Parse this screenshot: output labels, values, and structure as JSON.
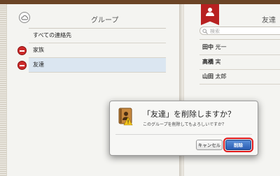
{
  "left_page": {
    "title": "グループ",
    "groups": [
      {
        "label": "すべての連絡先",
        "deletable": false,
        "selected": false
      },
      {
        "label": "家族",
        "deletable": true,
        "selected": false
      },
      {
        "label": "友達",
        "deletable": true,
        "selected": true
      }
    ]
  },
  "right_page": {
    "title": "友達",
    "search_placeholder": "検索",
    "contacts": [
      {
        "bold": "田中",
        "rest": " 光一"
      },
      {
        "bold": "高橋",
        "rest": " 実"
      },
      {
        "bold": "山田",
        "rest": " 太郎"
      }
    ]
  },
  "dialog": {
    "title": "「友達」を削除しますか？",
    "message": "このグループを削除してもよろしいですか？",
    "cancel_label": "キャンセル",
    "delete_label": "削除"
  },
  "colors": {
    "accent": "#2a5db3",
    "bookmark": "#b82121",
    "highlight_border": "#e0191b"
  }
}
